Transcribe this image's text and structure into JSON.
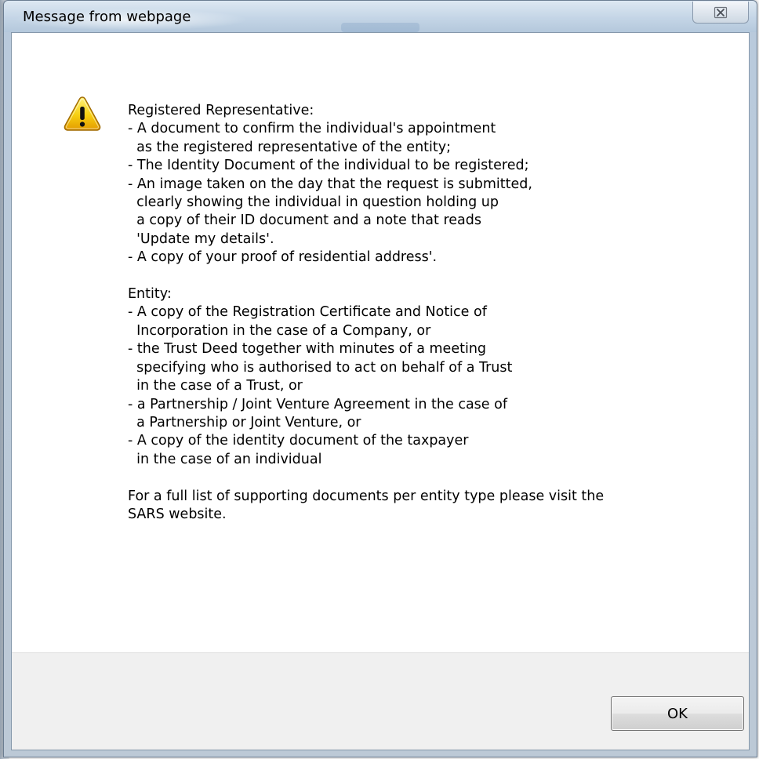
{
  "dialog": {
    "title": "Message from webpage",
    "close_glyph": "☒",
    "close_icon": "close-icon",
    "icon": "warning-icon",
    "colors": {
      "titlebar": "#c4d5e6",
      "frame_border": "#6b7d91",
      "footer": "#f0f0f0",
      "warning_yellow": "#f5c400"
    }
  },
  "message": {
    "lines": [
      "Registered Representative:",
      "- A document to confirm the individual's appointment",
      "  as the registered representative of the entity;",
      "- The Identity Document of the individual to be registered;",
      "- An image taken on the day that the request is submitted,",
      "  clearly showing the individual in question holding up",
      "  a copy of their ID document and a note that reads",
      "  'Update my details'.",
      "- A copy of your proof of residential address'.",
      "",
      "Entity:",
      "- A copy of the Registration Certificate and Notice of",
      "  Incorporation in the case of a Company, or",
      "- the Trust Deed together with minutes of a meeting",
      "  specifying who is authorised to act on behalf of a Trust",
      "  in the case of a Trust, or",
      "- a Partnership / Joint Venture Agreement in the case of",
      "  a Partnership or Joint Venture, or",
      "- A copy of the identity document of the taxpayer",
      "  in the case of an individual",
      "",
      "For a full list of supporting documents per entity type please visit the",
      "SARS website."
    ]
  },
  "buttons": {
    "ok_label": "OK"
  }
}
